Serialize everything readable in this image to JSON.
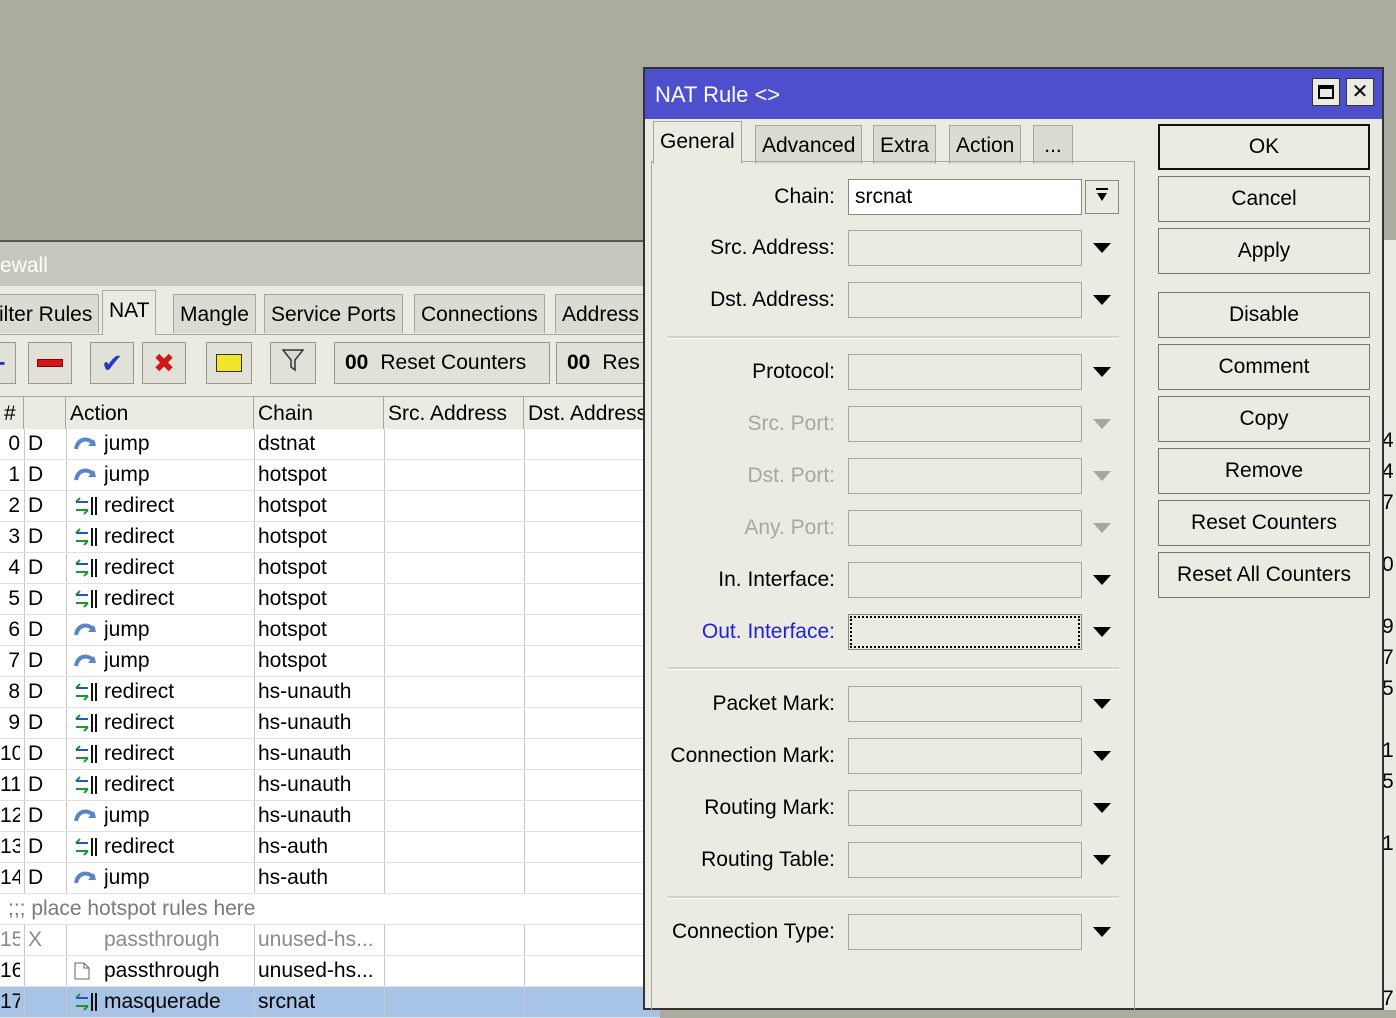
{
  "firewall": {
    "title": "ewall",
    "tabs": [
      "ilter Rules",
      "NAT",
      "Mangle",
      "Service Ports",
      "Connections",
      "Address"
    ],
    "toolbar": {
      "reset_counters": "Reset Counters",
      "reset_all_partial": "Res",
      "counter_icon_text": "00"
    },
    "columns": [
      "#",
      "Action",
      "Chain",
      "Src. Address",
      "Dst. Address"
    ],
    "rows": [
      {
        "num": "0",
        "flag": "D",
        "icon": "jump-icon",
        "action": "jump",
        "chain": "dstnat",
        "tail": "4"
      },
      {
        "num": "1",
        "flag": "D",
        "icon": "jump-icon",
        "action": "jump",
        "chain": "hotspot",
        "tail": "4"
      },
      {
        "num": "2",
        "flag": "D",
        "icon": "redirect-icon",
        "action": "redirect",
        "chain": "hotspot",
        "tail": "7"
      },
      {
        "num": "3",
        "flag": "D",
        "icon": "redirect-icon",
        "action": "redirect",
        "chain": "hotspot",
        "tail": ""
      },
      {
        "num": "4",
        "flag": "D",
        "icon": "redirect-icon",
        "action": "redirect",
        "chain": "hotspot",
        "tail": "0"
      },
      {
        "num": "5",
        "flag": "D",
        "icon": "redirect-icon",
        "action": "redirect",
        "chain": "hotspot",
        "tail": ""
      },
      {
        "num": "6",
        "flag": "D",
        "icon": "jump-icon",
        "action": "jump",
        "chain": "hotspot",
        "tail": "9"
      },
      {
        "num": "7",
        "flag": "D",
        "icon": "jump-icon",
        "action": "jump",
        "chain": "hotspot",
        "tail": "7"
      },
      {
        "num": "8",
        "flag": "D",
        "icon": "redirect-icon",
        "action": "redirect",
        "chain": "hs-unauth",
        "tail": "5"
      },
      {
        "num": "9",
        "flag": "D",
        "icon": "redirect-icon",
        "action": "redirect",
        "chain": "hs-unauth",
        "tail": ""
      },
      {
        "num": "10",
        "flag": "D",
        "icon": "redirect-icon",
        "action": "redirect",
        "chain": "hs-unauth",
        "tail": "1"
      },
      {
        "num": "11",
        "flag": "D",
        "icon": "redirect-icon",
        "action": "redirect",
        "chain": "hs-unauth",
        "tail": "5"
      },
      {
        "num": "12",
        "flag": "D",
        "icon": "jump-icon",
        "action": "jump",
        "chain": "hs-unauth",
        "tail": ""
      },
      {
        "num": "13",
        "flag": "D",
        "icon": "redirect-icon",
        "action": "redirect",
        "chain": "hs-auth",
        "tail": "1"
      },
      {
        "num": "14",
        "flag": "D",
        "icon": "jump-icon",
        "action": "jump",
        "chain": "hs-auth",
        "tail": ""
      }
    ],
    "comment": ";;; place hotspot rules here",
    "extra_rows": [
      {
        "num": "15",
        "flag": "X",
        "icon": "",
        "action": "passthrough",
        "chain": "unused-hs...",
        "tail": "",
        "style": "disabled"
      },
      {
        "num": "16",
        "flag": "",
        "icon": "note-icon",
        "action": "passthrough",
        "chain": "unused-hs...",
        "tail": "",
        "style": "normal"
      },
      {
        "num": "17",
        "flag": "",
        "icon": "redirect-icon",
        "action": "masquerade",
        "chain": "srcnat",
        "tail": "7",
        "style": "selected"
      }
    ]
  },
  "dialog": {
    "title": "NAT Rule <>",
    "tabs": [
      "General",
      "Advanced",
      "Extra",
      "Action",
      "..."
    ],
    "fields": {
      "chain_label": "Chain:",
      "chain_value": "srcnat",
      "src_address_label": "Src. Address:",
      "dst_address_label": "Dst. Address:",
      "protocol_label": "Protocol:",
      "src_port_label": "Src. Port:",
      "dst_port_label": "Dst. Port:",
      "any_port_label": "Any. Port:",
      "in_interface_label": "In. Interface:",
      "out_interface_label": "Out. Interface:",
      "packet_mark_label": "Packet Mark:",
      "connection_mark_label": "Connection Mark:",
      "routing_mark_label": "Routing Mark:",
      "routing_table_label": "Routing Table:",
      "connection_type_label": "Connection Type:"
    },
    "buttons": {
      "ok": "OK",
      "cancel": "Cancel",
      "apply": "Apply",
      "disable": "Disable",
      "comment": "Comment",
      "copy": "Copy",
      "remove": "Remove",
      "reset_counters": "Reset Counters",
      "reset_all_counters": "Reset All Counters"
    }
  },
  "colors": {
    "title_bar": "#4d4fcd",
    "selected_row": "#a7c4e6",
    "focus_label": "#1d24d6"
  }
}
